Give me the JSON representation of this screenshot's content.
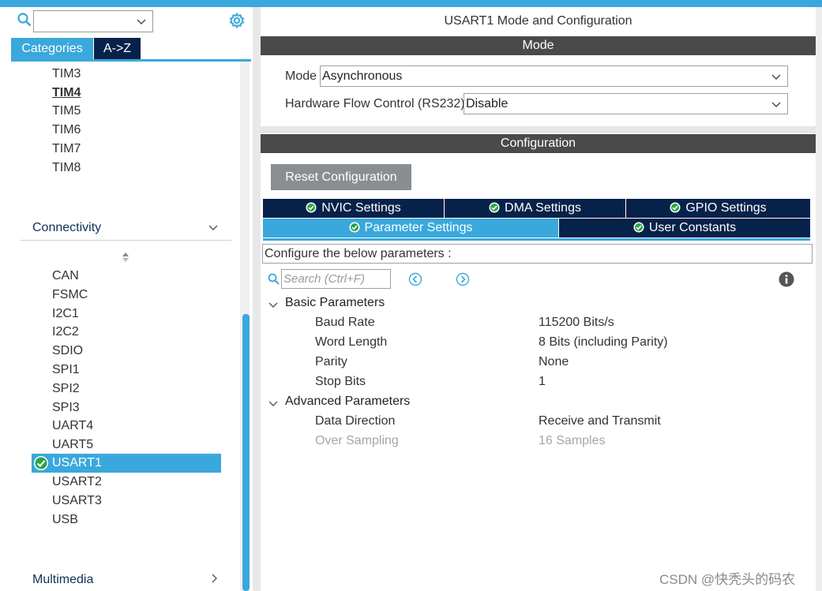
{
  "left": {
    "search_value": "",
    "tab_categories": "Categories",
    "tab_az": "A->Z",
    "timers": [
      "TIM3",
      "TIM4",
      "TIM5",
      "TIM6",
      "TIM7",
      "TIM8"
    ],
    "connectivity_label": "Connectivity",
    "connectivity_items": [
      "CAN",
      "FSMC",
      "I2C1",
      "I2C2",
      "SDIO",
      "SPI1",
      "SPI2",
      "SPI3",
      "UART4",
      "UART5"
    ],
    "selected_item": "USART1",
    "after_items": [
      "USART2",
      "USART3",
      "USB"
    ],
    "multimedia_label": "Multimedia"
  },
  "right": {
    "title": "USART1 Mode and Configuration",
    "mode_bar": "Mode",
    "mode_label": "Mode",
    "mode_value": "Asynchronous",
    "flow_label": "Hardware Flow Control (RS232)",
    "flow_value": "Disable",
    "config_bar": "Configuration",
    "reset_button": "Reset Configuration",
    "tabs": {
      "nvic": "NVIC Settings",
      "dma": "DMA Settings",
      "gpio": "GPIO Settings",
      "param": "Parameter Settings",
      "user": "User Constants"
    },
    "config_hint": "Configure the below parameters :",
    "search_placeholder": "Search (Ctrl+F)",
    "basic_section": "Basic Parameters",
    "basic": [
      {
        "name": "Baud Rate",
        "value": "115200 Bits/s"
      },
      {
        "name": "Word Length",
        "value": "8 Bits (including Parity)"
      },
      {
        "name": "Parity",
        "value": "None"
      },
      {
        "name": "Stop Bits",
        "value": "1"
      }
    ],
    "advanced_section": "Advanced Parameters",
    "advanced": [
      {
        "name": "Data Direction",
        "value": "Receive and Transmit"
      },
      {
        "name": "Over Sampling",
        "value": "16 Samples"
      }
    ]
  },
  "watermark": "CSDN @快秃头的码农",
  "colors": {
    "accent": "#3aa8dc",
    "navy": "#07224a",
    "bar": "#4a4a4a"
  }
}
